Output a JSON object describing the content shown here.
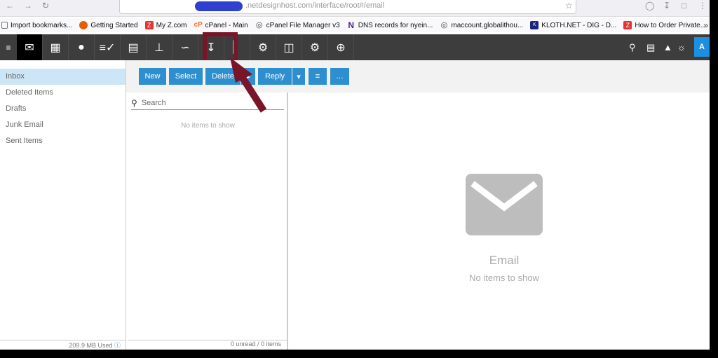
{
  "browser": {
    "url_fragment": ".netdesignhost.com/interface/root#/email"
  },
  "bookmarks": [
    {
      "label": "Import bookmarks...",
      "icon": "import-icon"
    },
    {
      "label": "Getting Started",
      "icon": "firefox-icon"
    },
    {
      "label": "My Z.com",
      "icon": "z-icon"
    },
    {
      "label": "cPanel - Main",
      "icon": "cpanel-icon"
    },
    {
      "label": "cPanel File Manager v3",
      "icon": "globe-icon"
    },
    {
      "label": "DNS records for nyein...",
      "icon": "n-icon"
    },
    {
      "label": "maccount.globalithou...",
      "icon": "globe-icon"
    },
    {
      "label": "KLOTH.NET - DIG - D...",
      "icon": "kloth-icon"
    },
    {
      "label": "How to Order Private...",
      "icon": "z-icon"
    }
  ],
  "toolbar_icons": [
    "mail-icon",
    "calendar-icon",
    "contacts-icon",
    "tasks-icon",
    "notes-icon",
    "sitemap-icon",
    "rss-icon",
    "archive-download-icon",
    "chart-icon",
    "settings-icon",
    "mobile-sync-icon",
    "advanced-settings-icon",
    "add-icon"
  ],
  "header_right": {
    "avatar_initial": "A"
  },
  "folders": [
    {
      "label": "Inbox",
      "selected": true
    },
    {
      "label": "Deleted Items",
      "selected": false
    },
    {
      "label": "Drafts",
      "selected": false
    },
    {
      "label": "Junk Email",
      "selected": false
    },
    {
      "label": "Sent Items",
      "selected": false
    }
  ],
  "storage_used": "209.9 MB Used",
  "actions": {
    "new": "New",
    "select": "Select",
    "delete": "Delete",
    "reply": "Reply",
    "more": "…"
  },
  "search": {
    "placeholder": "Search"
  },
  "list": {
    "empty": "No items to show",
    "status": "0 unread / 0 items"
  },
  "reading": {
    "title": "Email",
    "subtitle": "No items to show"
  },
  "colors": {
    "accent": "#2d8fd0",
    "toolbar": "#3d3d3d",
    "annotation": "#7a1428"
  }
}
